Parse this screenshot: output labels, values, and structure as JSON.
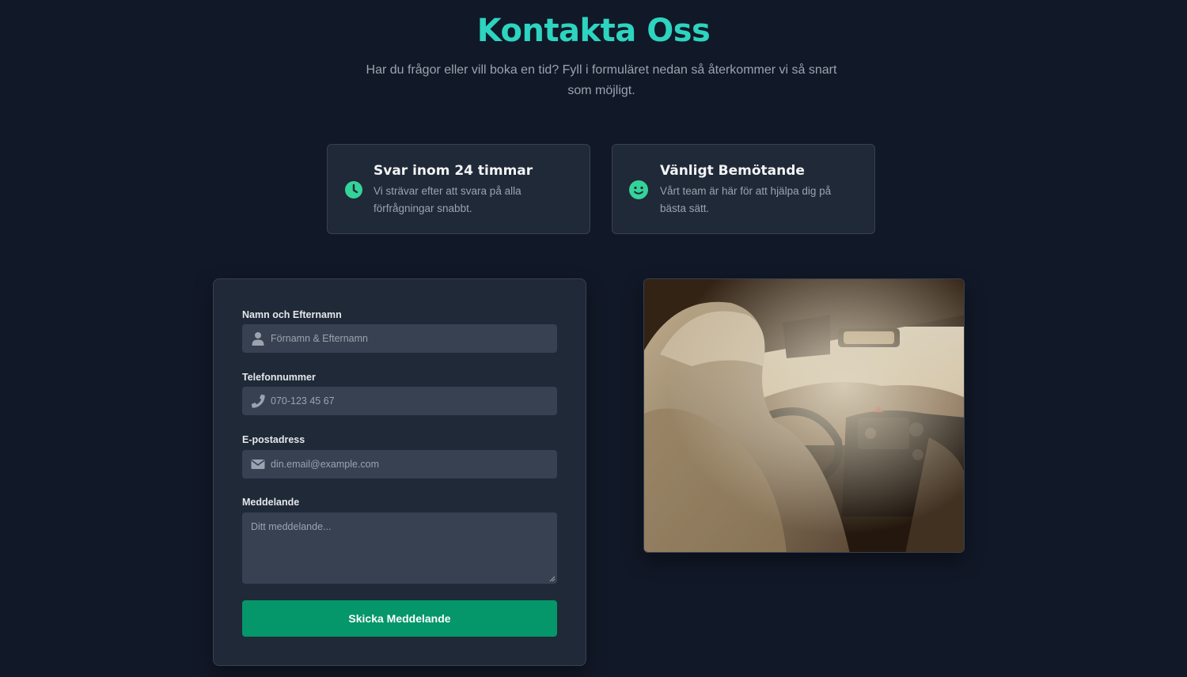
{
  "header": {
    "title": "Kontakta Oss",
    "subtitle": "Har du frågor eller vill boka en tid? Fyll i formuläret nedan så återkommer vi så snart som möjligt."
  },
  "features": [
    {
      "icon": "clock-icon",
      "title": "Svar inom 24 timmar",
      "description": "Vi strävar efter att svara på alla förfrågningar snabbt."
    },
    {
      "icon": "smiley-icon",
      "title": "Vänligt Bemötande",
      "description": "Vårt team är här för att hjälpa dig på bästa sätt."
    }
  ],
  "form": {
    "name": {
      "label": "Namn och Efternamn",
      "placeholder": "Förnamn & Efternamn",
      "value": "",
      "icon": "user-icon"
    },
    "phone": {
      "label": "Telefonnummer",
      "placeholder": "070-123 45 67",
      "value": "",
      "icon": "phone-icon"
    },
    "email": {
      "label": "E-postadress",
      "placeholder": "din.email@example.com",
      "value": "",
      "icon": "envelope-icon"
    },
    "message": {
      "label": "Meddelande",
      "placeholder": "Ditt meddelande...",
      "value": ""
    },
    "submit_label": "Skicka Meddelande"
  },
  "colors": {
    "accent_teal": "#2dd4bf",
    "icon_green": "#34d399",
    "button_green": "#059669",
    "background": "#111827",
    "card": "#1f2937",
    "input": "#374151"
  }
}
